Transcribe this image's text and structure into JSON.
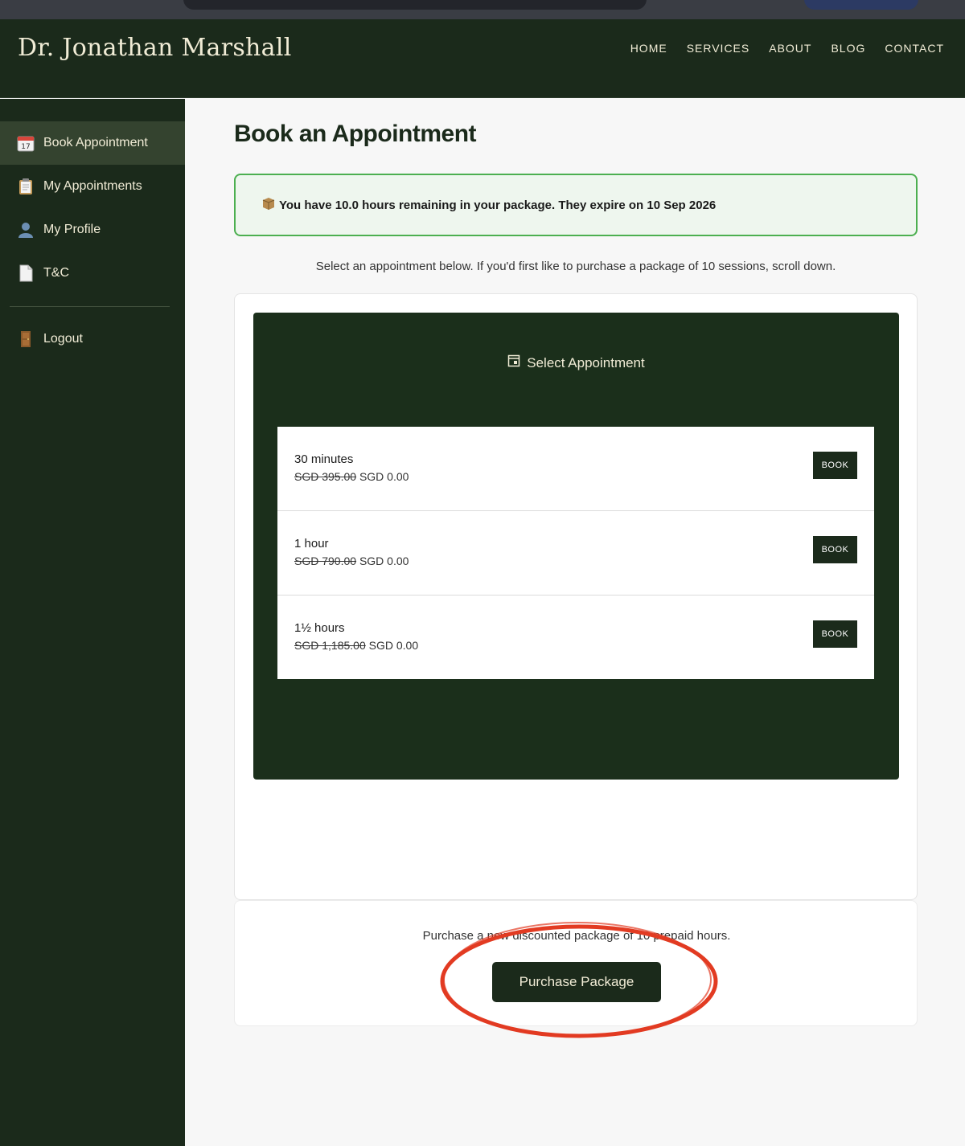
{
  "header": {
    "brand": "Dr. Jonathan Marshall",
    "nav": [
      "HOME",
      "SERVICES",
      "ABOUT",
      "BLOG",
      "CONTACT"
    ]
  },
  "sidebar": {
    "items": [
      {
        "label": "Book Appointment",
        "icon": "calendar-icon"
      },
      {
        "label": "My Appointments",
        "icon": "clipboard-icon"
      },
      {
        "label": "My Profile",
        "icon": "user-icon"
      },
      {
        "label": "T&C",
        "icon": "document-icon"
      },
      {
        "label": "Logout",
        "icon": "door-icon"
      }
    ]
  },
  "main": {
    "title": "Book an Appointment",
    "notice": "You have 10.0 hours remaining in your package. They expire on 10 Sep 2026",
    "intro": "Select an appointment below. If you'd first like to purchase a package of 10 sessions, scroll down.",
    "panel_title": "Select Appointment",
    "appointments": [
      {
        "name": "30 minutes",
        "old_price": "SGD 395.00",
        "price": "SGD 0.00",
        "button": "BOOK"
      },
      {
        "name": "1 hour",
        "old_price": "SGD 790.00",
        "price": "SGD 0.00",
        "button": "BOOK"
      },
      {
        "name": "1½ hours",
        "old_price": "SGD 1,185.00",
        "price": "SGD 0.00",
        "button": "BOOK"
      }
    ],
    "purchase_text": "Purchase a new discounted package of 10 prepaid hours.",
    "purchase_button": "Purchase Package"
  },
  "colors": {
    "dark_green": "#1b2a1b",
    "cream": "#f1ecd6",
    "notice_border": "#4caf50",
    "annotation_red": "#e23b22"
  }
}
